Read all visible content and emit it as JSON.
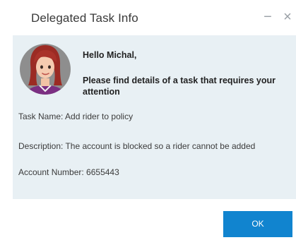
{
  "window": {
    "title": "Delegated Task Info",
    "minimize_symbol": "−",
    "close_symbol": "×"
  },
  "message": {
    "greeting": "Hello Michal,",
    "body": "Please find details of a task that requires your attention"
  },
  "task": {
    "name_line": "Task Name: Add rider to policy",
    "description_line": "Description: The account is blocked so a rider cannot be added",
    "account_line": "Account Number: 6655443"
  },
  "footer": {
    "ok_label": "OK"
  },
  "colors": {
    "content_background": "#e8f0f4",
    "ok_button": "#1184cf"
  },
  "icons": {
    "avatar": "woman-avatar-icon",
    "minimize": "minimize-icon",
    "close": "close-icon"
  }
}
